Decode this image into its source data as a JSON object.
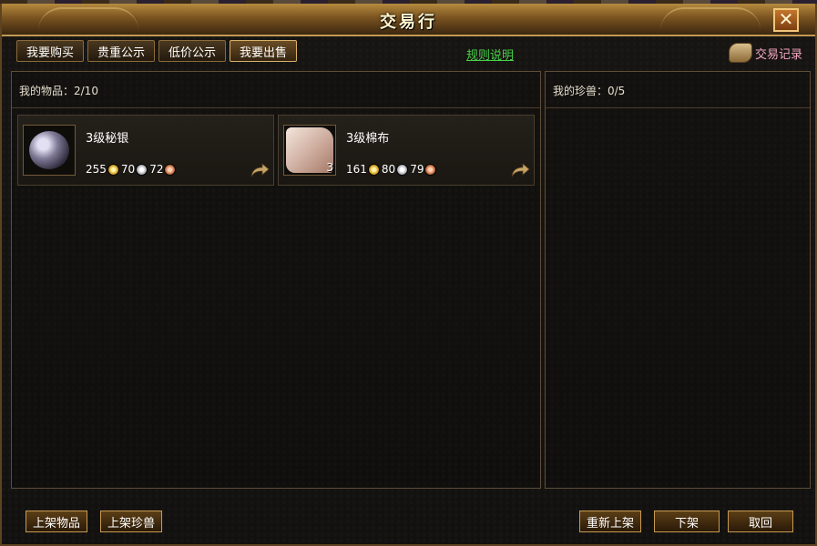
{
  "window": {
    "title": "交易行",
    "close_label": "✕"
  },
  "tabs": [
    {
      "label": "我要购买"
    },
    {
      "label": "贵重公示"
    },
    {
      "label": "低价公示"
    },
    {
      "label": "我要出售"
    }
  ],
  "rules_link": "规则说明",
  "trade_record_label": "交易记录",
  "items_panel": {
    "title": "我的物品：2/10",
    "items": [
      {
        "name": "3级秘银",
        "count": "",
        "gold": "255",
        "silver": "70",
        "copper": "72"
      },
      {
        "name": "3级棉布",
        "count": "3",
        "gold": "161",
        "silver": "80",
        "copper": "79"
      }
    ]
  },
  "pets_panel": {
    "title": "我的珍兽：0/5"
  },
  "bottom_buttons": {
    "list_item": "上架物品",
    "list_pet": "上架珍兽",
    "relist": "重新上架",
    "delist": "下架",
    "cancel": "取回"
  },
  "colors": {
    "accent_gold": "#c79a52",
    "link_green": "#48d04a",
    "record_pink": "#f2a6c2"
  },
  "icons": {
    "close": "close-icon",
    "record": "scroll-icon",
    "send": "arrow-icon"
  }
}
